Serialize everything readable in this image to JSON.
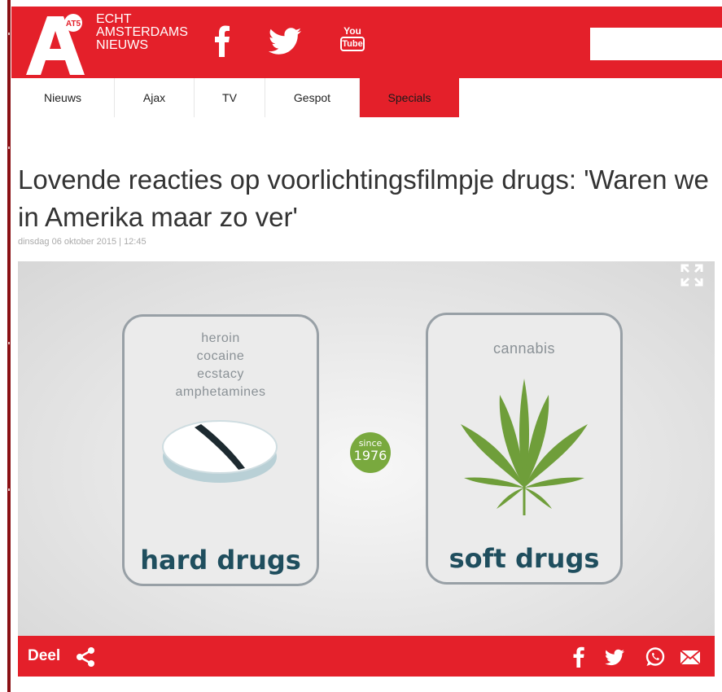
{
  "header": {
    "logo_text": "A",
    "logo_badge": "AT5",
    "brand_lines": [
      "ECHT",
      "AMSTERDAMS",
      "NIEUWS"
    ],
    "social_icons": [
      "facebook-icon",
      "twitter-icon",
      "youtube-icon"
    ],
    "youtube_label_top": "You",
    "youtube_label_bottom": "Tube",
    "search_placeholder": ""
  },
  "nav": {
    "items": [
      {
        "label": "Nieuws"
      },
      {
        "label": "Ajax"
      },
      {
        "label": "TV"
      },
      {
        "label": "Gespot"
      },
      {
        "label": "Specials",
        "active": true
      }
    ]
  },
  "article": {
    "title": "Lovende reacties op voorlichtingsfilmpje drugs: 'Waren we in Amerika maar zo ver'",
    "date": "dinsdag 06 oktober 2015 | 12:45"
  },
  "video": {
    "hard_card": {
      "items": [
        "heroin",
        "cocaine",
        "ecstacy",
        "amphetamines"
      ],
      "title": "hard drugs"
    },
    "since_badge": {
      "line1": "since",
      "line2": "1976"
    },
    "soft_card": {
      "items": [
        "cannabis"
      ],
      "title": "soft drugs"
    }
  },
  "share_bar": {
    "label": "Deel",
    "icons": [
      "share-icon",
      "facebook-icon",
      "twitter-icon",
      "whatsapp-icon",
      "mail-icon"
    ]
  },
  "colors": {
    "brand_red": "#e4202a",
    "card_title": "#1f4e5e",
    "badge_green": "#79a93e",
    "leaf_green": "#6f9e3a"
  }
}
